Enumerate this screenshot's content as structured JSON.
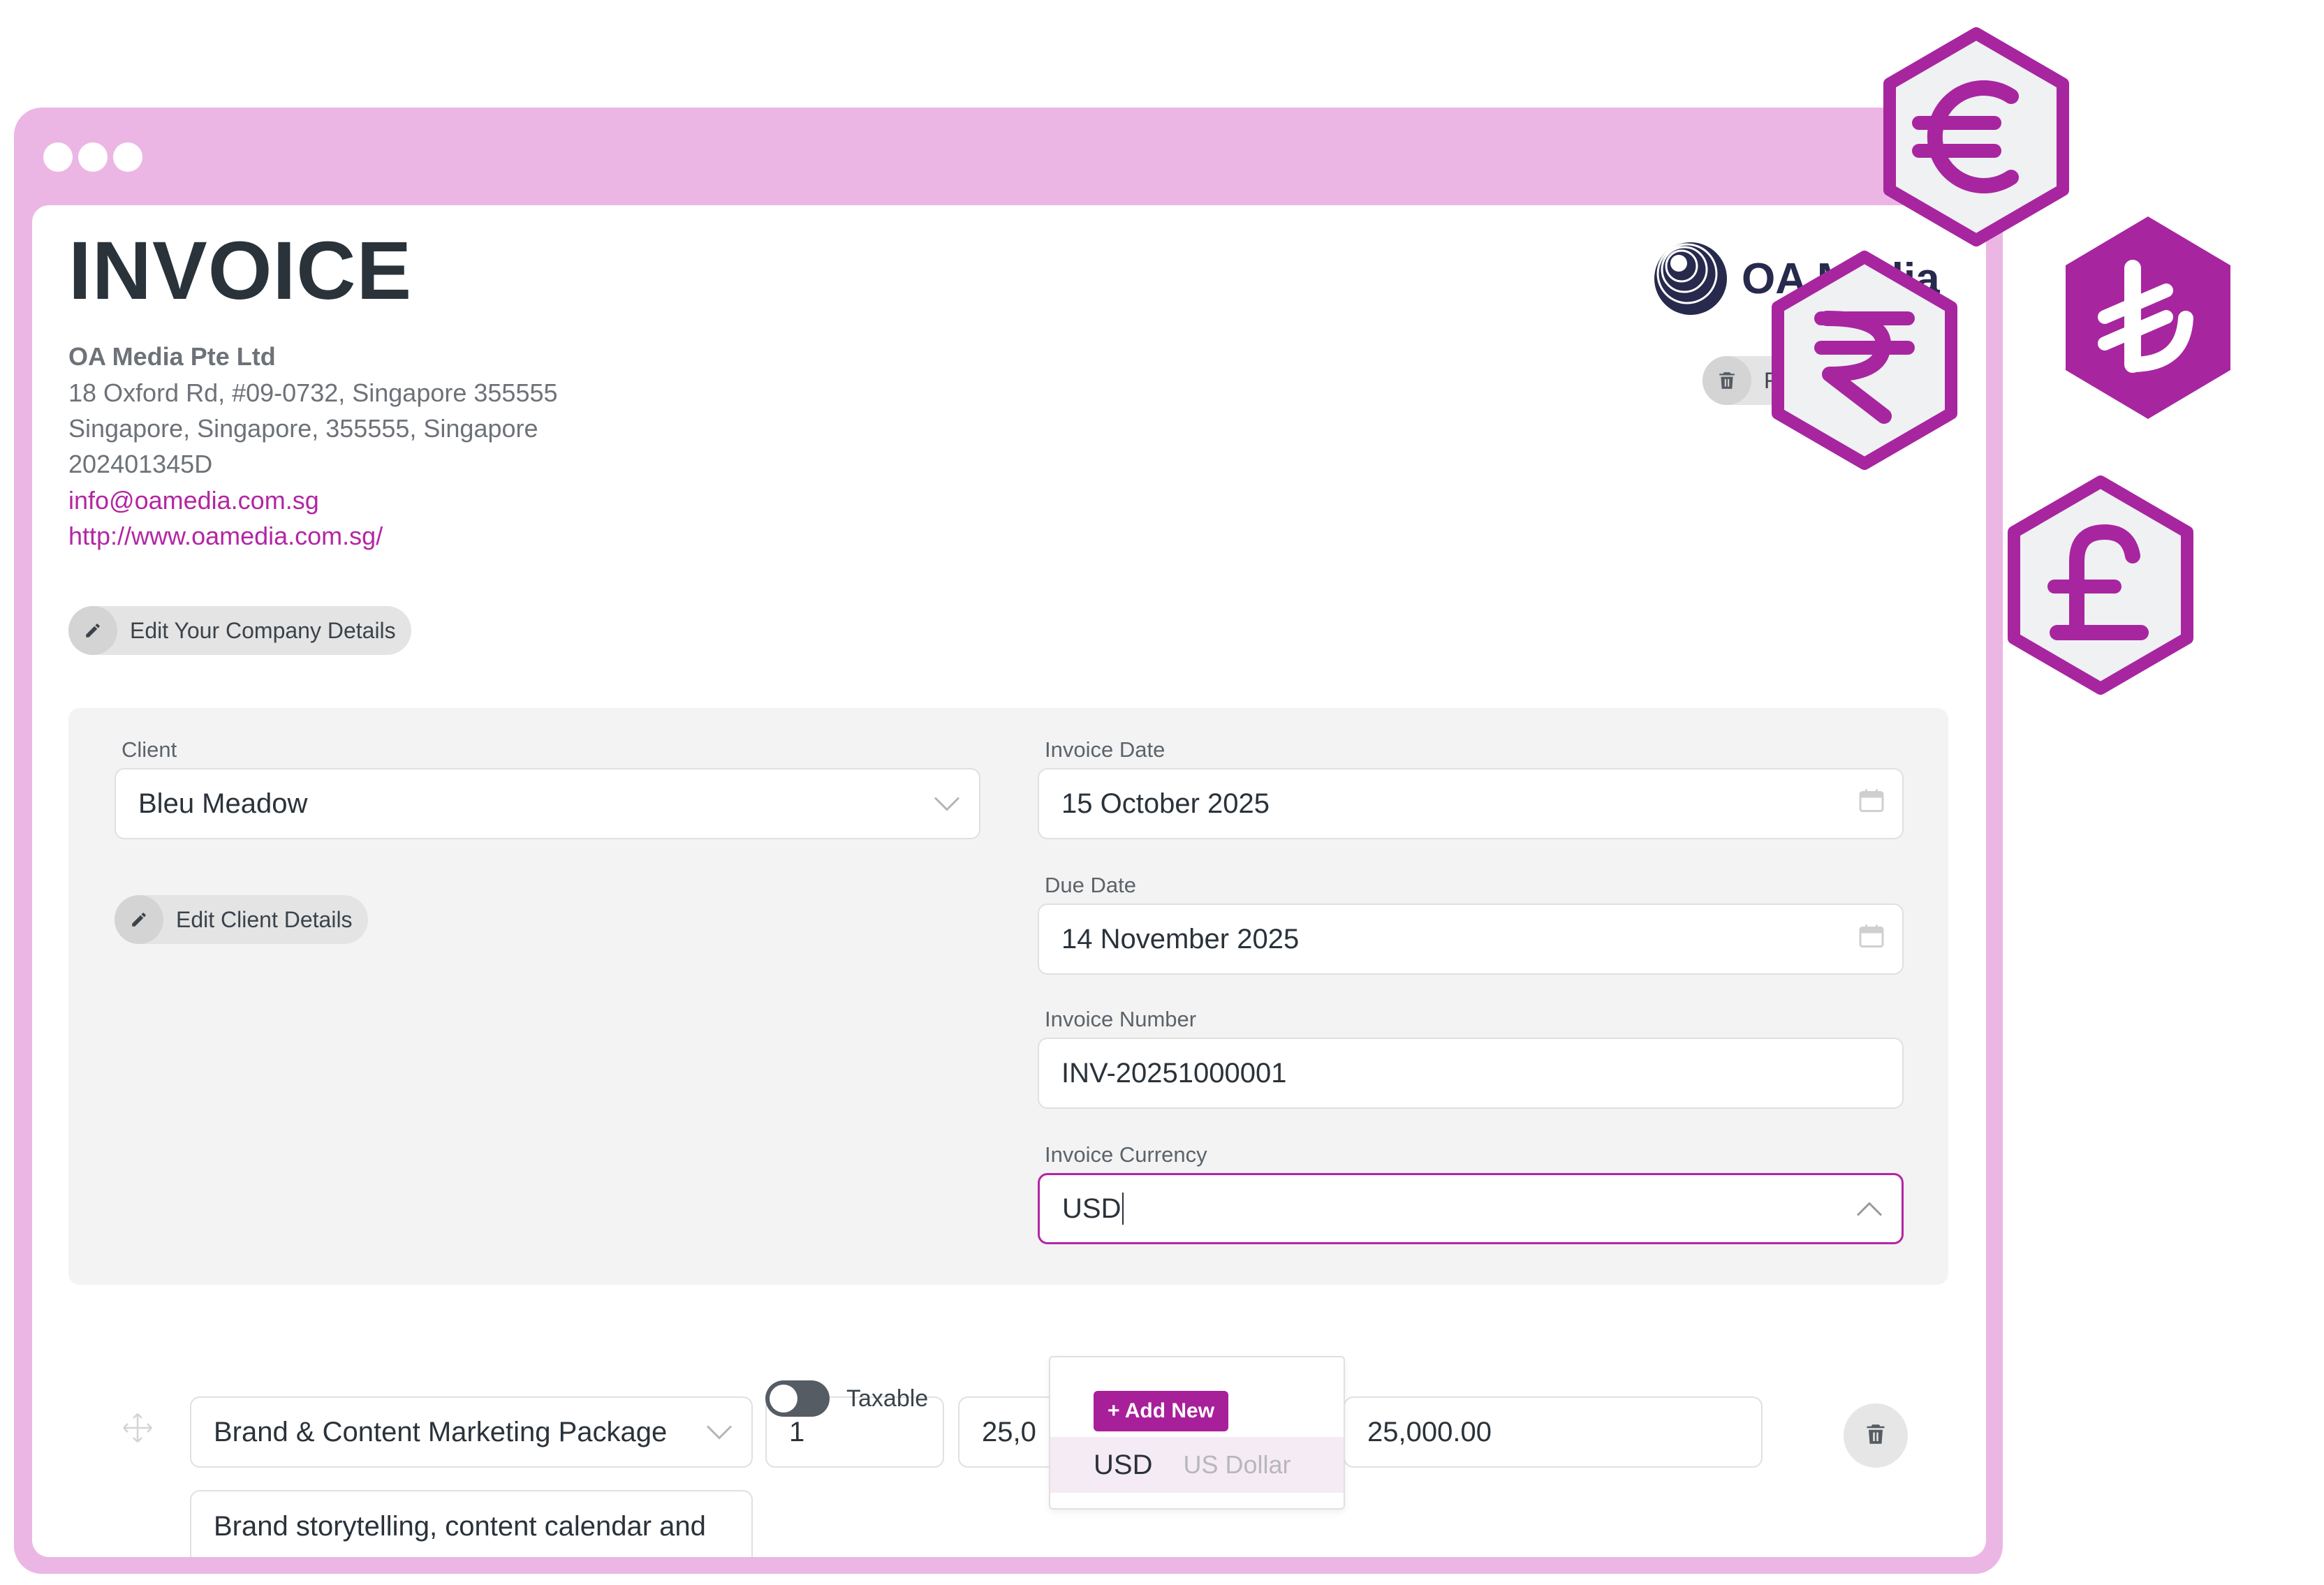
{
  "invoice": {
    "title": "INVOICE"
  },
  "company": {
    "name": "OA Media Pte Ltd",
    "address": "18 Oxford Rd, #09-0732, Singapore 355555",
    "city_line": "Singapore, Singapore, 355555, Singapore",
    "reg_no": "202401345D",
    "email": "info@oamedia.com.sg",
    "website": "http://www.oamedia.com.sg/",
    "edit_label": "Edit Your Company Details",
    "logo_text": "OA Media",
    "logo_button_label": "R"
  },
  "client": {
    "label": "Client",
    "value": "Bleu Meadow",
    "edit_label": "Edit Client Details"
  },
  "invoice_date": {
    "label": "Invoice Date",
    "value": "15 October 2025"
  },
  "due_date": {
    "label": "Due Date",
    "value": "14 November 2025"
  },
  "invoice_number": {
    "label": "Invoice Number",
    "value": "INV-20251000001"
  },
  "currency": {
    "label": "Invoice Currency",
    "value": "USD",
    "add_new": "+ Add New",
    "options": [
      {
        "code": "USD",
        "name": "US Dollar"
      }
    ]
  },
  "line_item": {
    "product": "Brand & Content Marketing Package",
    "quantity": "1",
    "rate": "25,0",
    "amount": "25,000.00",
    "description": "Brand storytelling, content calendar and copywriting",
    "taxable_label": "Taxable",
    "taxable": false
  },
  "currency_badges": [
    "euro-icon",
    "lira-icon",
    "rupee-icon",
    "pound-icon"
  ],
  "colors": {
    "accent": "#b326a4",
    "frame": "#ebb6e4",
    "badge_fill": "#f0f1f3",
    "badge_solid": "#a825a0"
  }
}
